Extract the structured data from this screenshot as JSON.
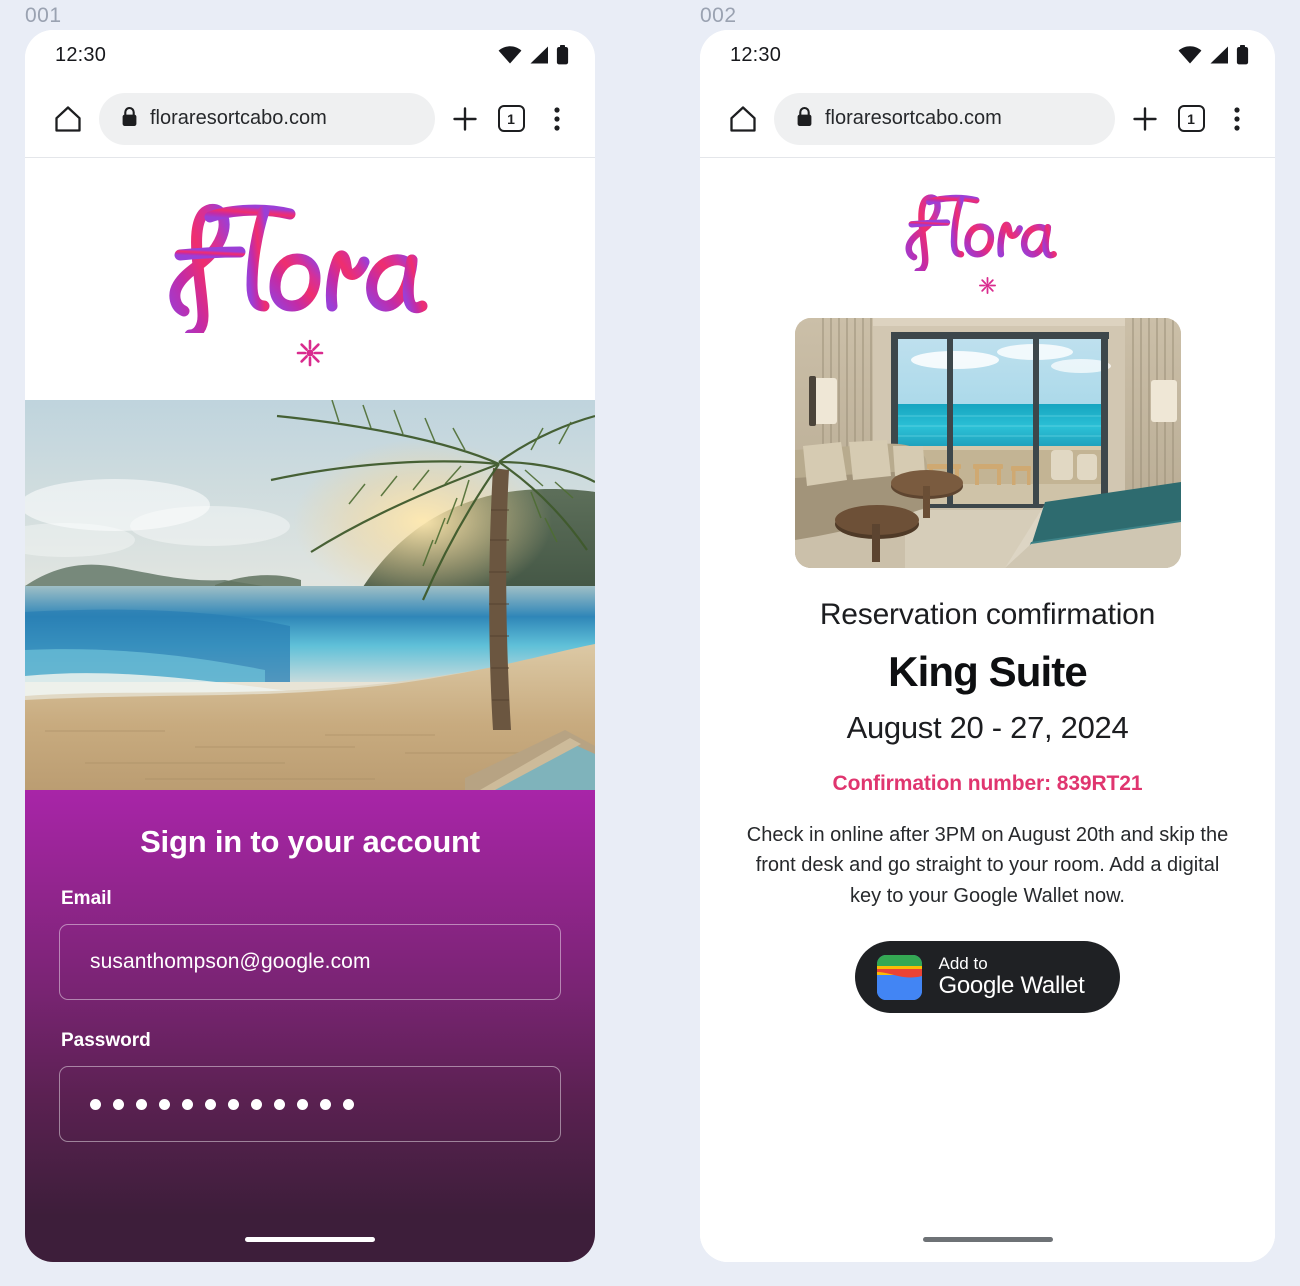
{
  "page": {
    "background_color": "#e9edf6",
    "frames": [
      {
        "label": "001"
      },
      {
        "label": "002"
      }
    ]
  },
  "status_bar": {
    "time": "12:30",
    "icons": [
      "wifi-icon",
      "cell-signal-icon",
      "battery-icon"
    ]
  },
  "browser": {
    "home_icon": "home-icon",
    "lock_icon": "lock-icon",
    "url": "floraresortcabo.com",
    "new_tab_icon": "plus-icon",
    "tab_count": "1",
    "menu_icon": "more-vert-icon"
  },
  "brand": {
    "wordmark": "Flora",
    "flower_icon": "asterisk-flower-icon",
    "gradient_start": "#ef2e6e",
    "gradient_end": "#9c3fd4",
    "accent_pink": "#e0356f"
  },
  "signin": {
    "hero_image": "tropical-beach-sunset-photo",
    "heading": "Sign in to your account",
    "email": {
      "label": "Email",
      "value": "susanthompson@google.com",
      "placeholder": "Email"
    },
    "password": {
      "label": "Password",
      "value": "............",
      "dot_count": 12,
      "placeholder": "Password"
    },
    "panel_gradient_top": "#a825a8",
    "panel_gradient_bottom": "#3d1e3a"
  },
  "confirmation": {
    "room_image": "hotel-suite-ocean-view-photo",
    "subtitle": "Reservation comfirmation",
    "room_name": "King Suite",
    "dates": "August 20 - 27, 2024",
    "confirmation_number": "Confirmation number: 839RT21",
    "body": "Check in online after 3PM on August 20th and skip the front desk and go straight to your room. Add a digital key to your Google Wallet now.",
    "wallet_button": {
      "icon": "google-wallet-icon",
      "line1": "Add to",
      "line2": "Google Wallet",
      "background_color": "#1f2124"
    }
  }
}
